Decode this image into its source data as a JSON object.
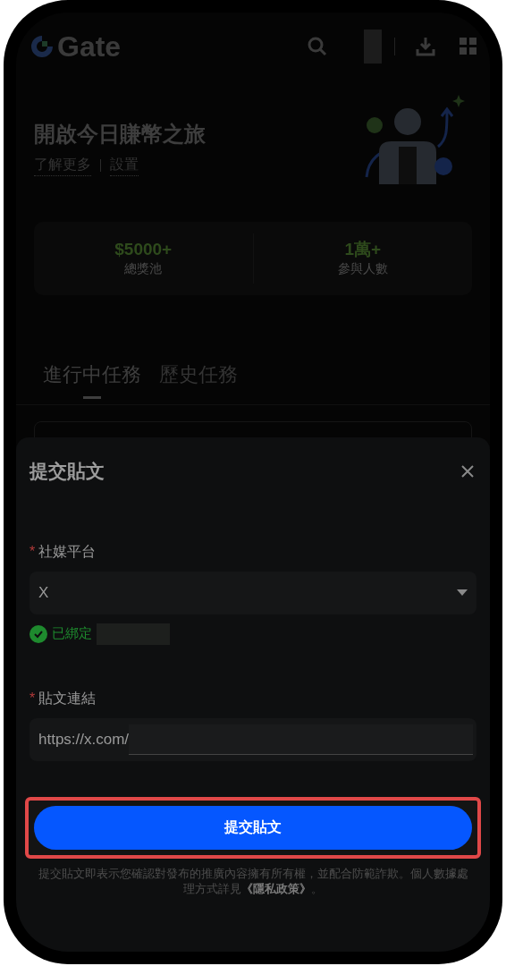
{
  "header": {
    "logo": "Gate"
  },
  "hero": {
    "title": "開啟今日賺幣之旅",
    "links": [
      "了解更多",
      "設置"
    ]
  },
  "stats": [
    {
      "value": "$5000+",
      "label": "總獎池"
    },
    {
      "value": "1萬+",
      "label": "參與人數"
    }
  ],
  "tabs": [
    {
      "label": "進行中任務",
      "selected": true
    },
    {
      "label": "歷史任務",
      "selected": false
    }
  ],
  "modal": {
    "title": "提交貼文",
    "platform": {
      "mark": "*",
      "label": "社媒平台",
      "value": "X",
      "status": "已綁定"
    },
    "link": {
      "mark": "*",
      "label": "貼文連結",
      "value": "https://x.com/"
    },
    "submit": "提交貼文",
    "disclaimer": "提交貼文即表示您確認對發布的推廣內容擁有所有權，並配合防範詐欺。個人數據處理方式詳見",
    "policy_link": "《隱私政策》",
    "disclaimer_end": "。"
  }
}
